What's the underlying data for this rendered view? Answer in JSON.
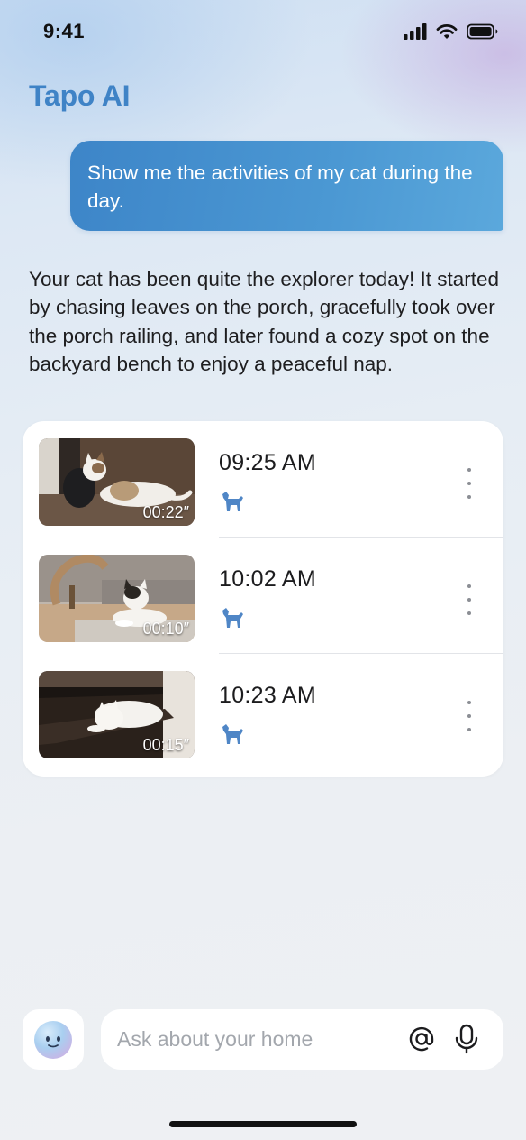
{
  "status_bar": {
    "time": "9:41"
  },
  "app": {
    "title": "Tapo AI"
  },
  "conversation": {
    "user_message": "Show me the activities of my cat during the day.",
    "assistant_reply": "Your cat has been quite the explorer today! It started by chasing leaves on the porch, gracefully took over the porch railing, and later found a cozy spot on the backyard bench to enjoy a peaceful nap."
  },
  "events": [
    {
      "time": "09:25 AM",
      "duration": "00:22″",
      "detection_icon": "pet-icon",
      "thumbnail": "cat lying on rug near dark bag"
    },
    {
      "time": "10:02 AM",
      "duration": "00:10″",
      "detection_icon": "pet-icon",
      "thumbnail": "cat sitting on floor with scratching post"
    },
    {
      "time": "10:23 AM",
      "duration": "00:15″",
      "detection_icon": "pet-icon",
      "thumbnail": "white cat sleeping on dark shelf"
    }
  ],
  "input": {
    "placeholder": "Ask about your home"
  },
  "colors": {
    "accent": "#3f83c6",
    "bubble": "#4a94d0",
    "pet_icon": "#4f86c6"
  }
}
